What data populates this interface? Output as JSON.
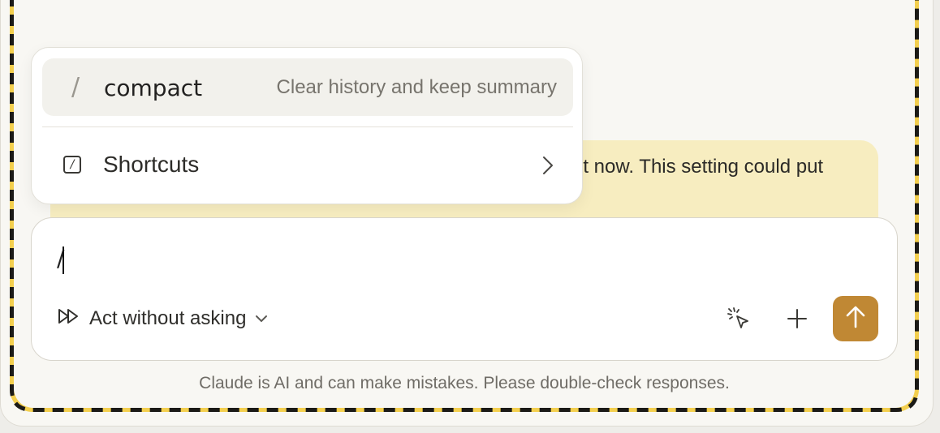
{
  "warning": {
    "visible_text": "et now. This setting could put"
  },
  "composer": {
    "input_value": "/",
    "mode_label": "Act without asking",
    "icons": {
      "mode": "fast-forward-icon",
      "mode_dropdown": "chevron-down-icon",
      "cursor_tool": "pointer-click-icon",
      "add": "plus-icon",
      "send": "arrow-up-icon"
    },
    "send_color": "#c08834"
  },
  "slash_menu": {
    "items": [
      {
        "prefix": "/",
        "command": "compact",
        "description": "Clear history and keep summary"
      },
      {
        "icon": "slash-box-icon",
        "label": "Shortcuts",
        "trailing_icon": "chevron-right-icon"
      }
    ]
  },
  "footer": {
    "disclaimer": "Claude is AI and can make mistakes. Please double-check responses."
  },
  "colors": {
    "frame_dash_primary": "#1b1a17",
    "frame_dash_secondary": "#f3cf4f",
    "warning_bg": "#f7edc0"
  }
}
